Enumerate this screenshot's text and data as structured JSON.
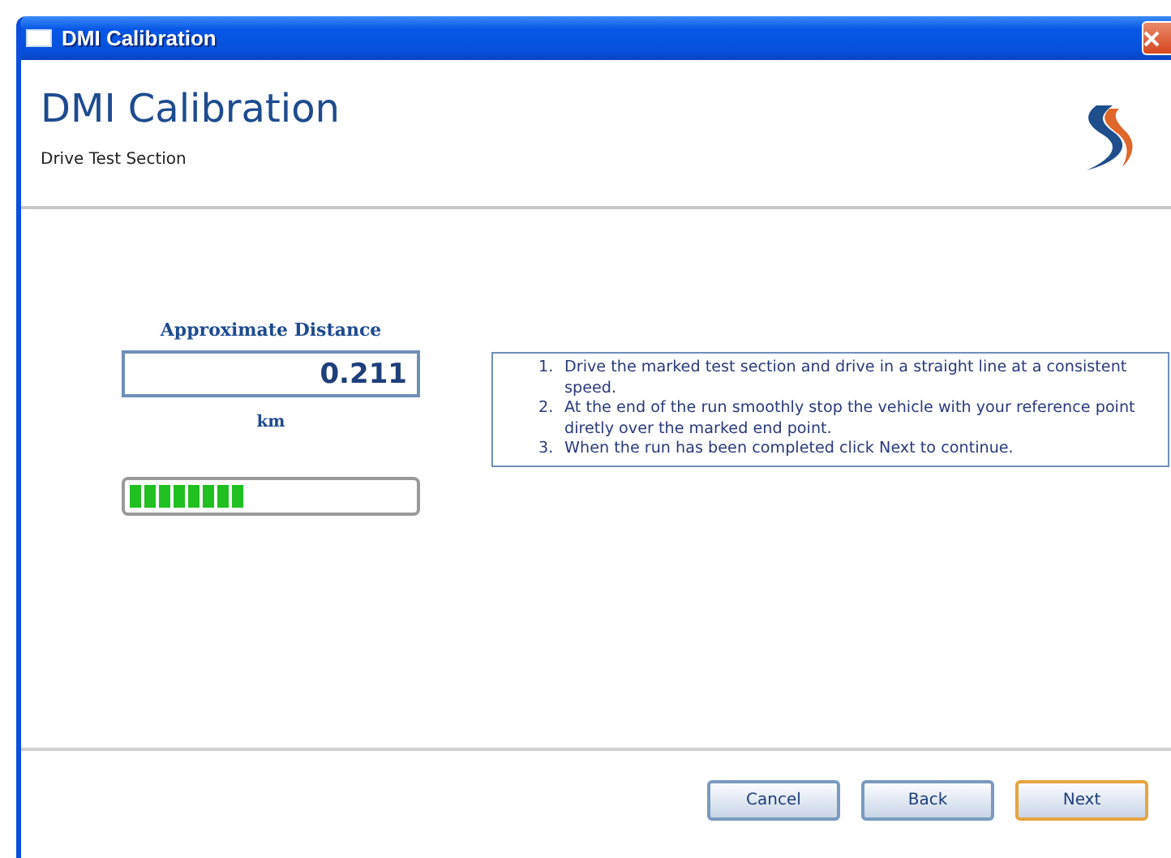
{
  "window": {
    "title": "DMI Calibration"
  },
  "header": {
    "title": "DMI Calibration",
    "subtitle": "Drive Test Section"
  },
  "distance": {
    "label": "Approximate Distance",
    "value": "0.211",
    "unit": "km"
  },
  "progress": {
    "level": 0.41
  },
  "instructions": [
    {
      "number": "1.",
      "text": "Drive the marked test section and drive in a straight line at a consistent speed."
    },
    {
      "number": "2.",
      "text": "At the end of the run smoothly stop the vehicle with your reference point diretly over the marked end point."
    },
    {
      "number": "3.",
      "text": "When the run has been completed click Next to continue."
    }
  ],
  "buttons": [
    {
      "label": "Cancel",
      "default": false
    },
    {
      "label": "Back",
      "default": false
    },
    {
      "label": "Next",
      "default": true
    }
  ]
}
